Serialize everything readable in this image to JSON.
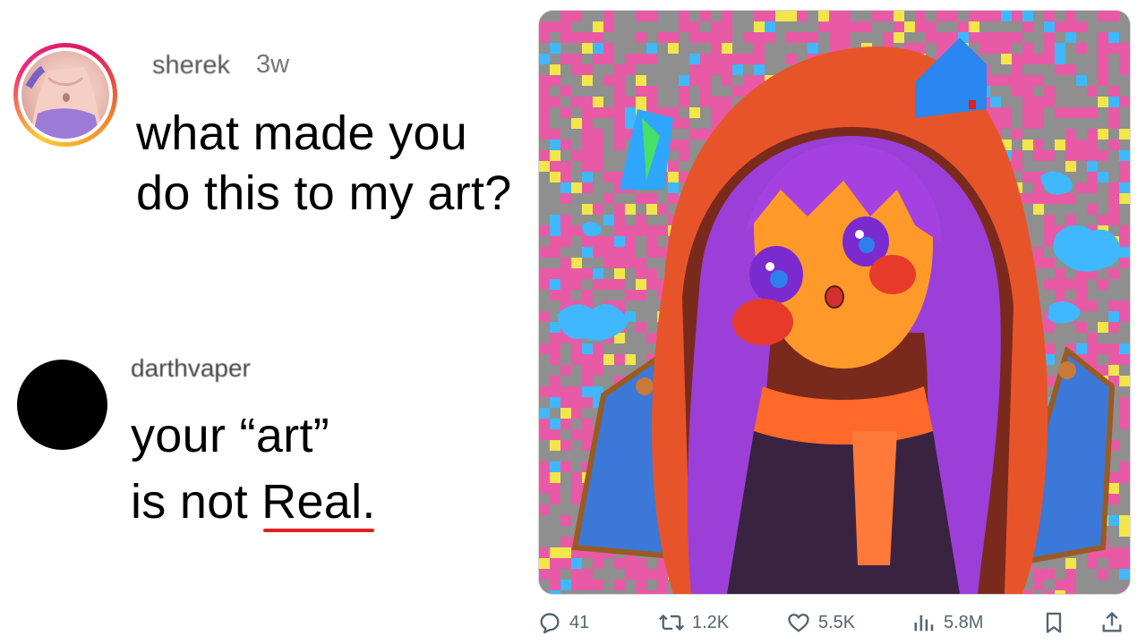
{
  "comment1": {
    "username": "sherek",
    "age": "3w",
    "text": "what made you do this to my art?",
    "avatar": "torso-photo-avatar"
  },
  "comment2": {
    "username": "darthvaper",
    "line1": "your “art”",
    "line2_prefix": "is not ",
    "line2_emphasis": "Real.",
    "avatar": "black-circle-avatar",
    "underline_color": "#e0221e"
  },
  "artwork": {
    "subject": "anime-girl-in-red-dragon-hoodie-with-bat-wings",
    "palette": [
      "#e85aa6",
      "#8f8f8f",
      "#f2e64a",
      "#3fb8ff",
      "#9b3fd8",
      "#ff6a2a",
      "#d22f2f",
      "#3b78d8"
    ]
  },
  "actions": {
    "reply": {
      "icon": "reply-bubble-icon",
      "count": "41"
    },
    "repost": {
      "icon": "repost-arrows-icon",
      "count": "1.2K"
    },
    "like": {
      "icon": "heart-icon",
      "count": "5.5K"
    },
    "views": {
      "icon": "views-bars-icon",
      "count": "5.8M"
    },
    "bookmark": {
      "icon": "bookmark-icon"
    },
    "share": {
      "icon": "share-upload-icon"
    }
  },
  "colors": {
    "action_gray": "#536471",
    "ring_gradient": [
      "#f9ce34",
      "#ee2a7b",
      "#f58529"
    ]
  }
}
